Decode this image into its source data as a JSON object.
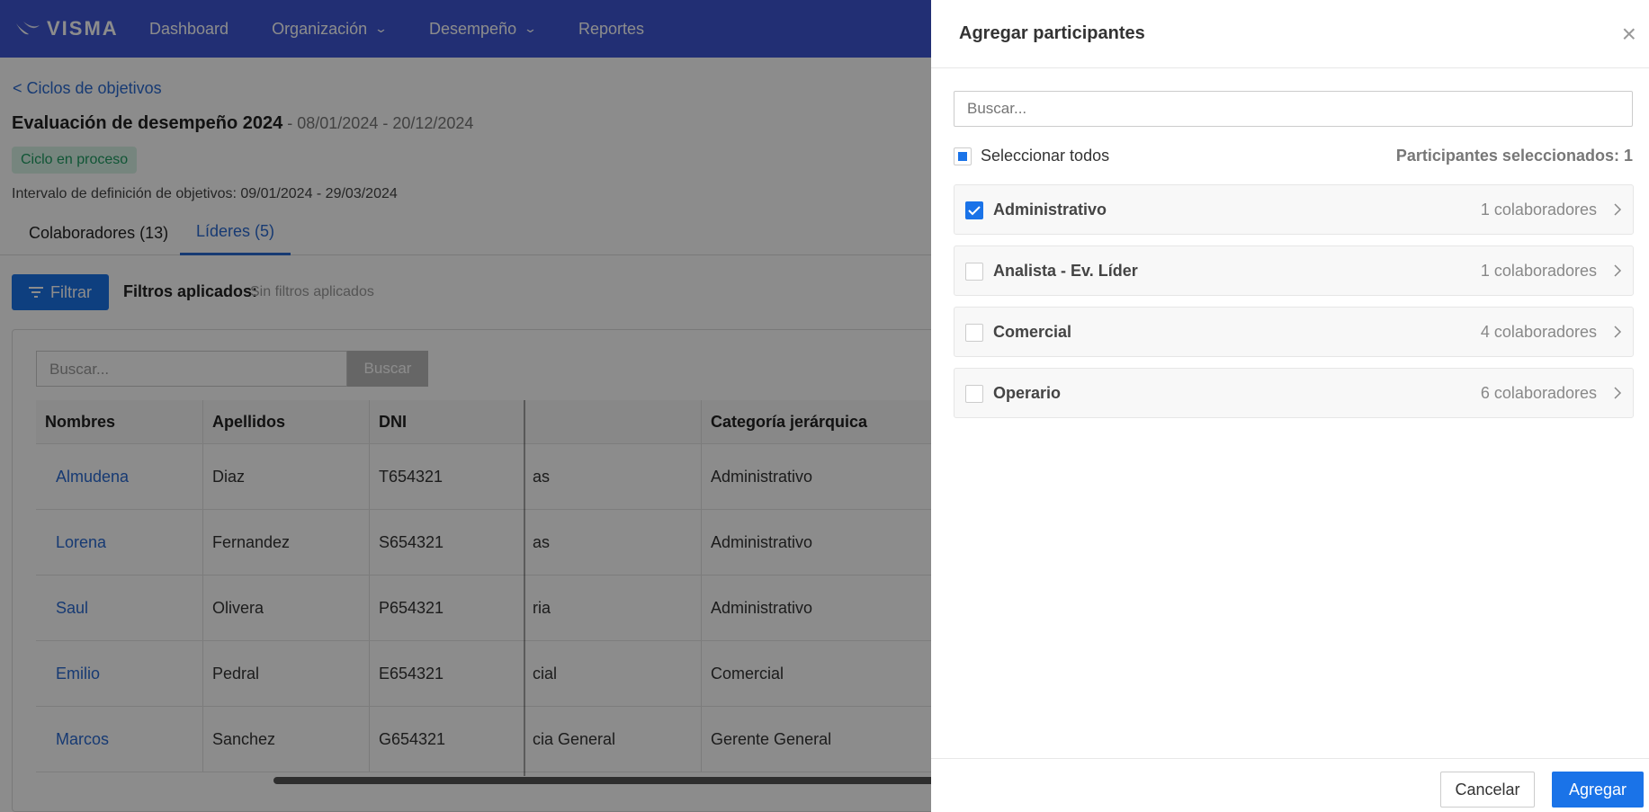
{
  "topnav": {
    "logo": "VISMA",
    "items": [
      "Dashboard",
      "Organización",
      "Desempeño",
      "Reportes"
    ]
  },
  "page": {
    "back_link": "< Ciclos de objetivos",
    "title": "Evaluación de desempeño 2024",
    "dates": " - 08/01/2024 - 20/12/2024",
    "status": "Ciclo en proceso",
    "interval": "Intervalo de definición de objetivos: 09/01/2024 - 29/03/2024",
    "tabs": [
      "Colaboradores (13)",
      "Líderes (5)"
    ],
    "filter_button": "Filtrar",
    "filters_label": "Filtros aplicados:",
    "filters_value": "Sin filtros aplicados",
    "search_placeholder": "Buscar...",
    "search_button": "Buscar",
    "table": {
      "headers": [
        "Nombres",
        "Apellidos",
        "DNI",
        "",
        "Categoría jerárquica"
      ],
      "rows": [
        [
          "Almudena",
          "Diaz",
          "T654321",
          "as",
          "Administrativo"
        ],
        [
          "Lorena",
          "Fernandez",
          "S654321",
          "as",
          "Administrativo"
        ],
        [
          "Saul",
          "Olivera",
          "P654321",
          "ria",
          "Administrativo"
        ],
        [
          "Emilio",
          "Pedral",
          "E654321",
          "cial",
          "Comercial"
        ],
        [
          "Marcos",
          "Sanchez",
          "G654321",
          "cia General",
          "Gerente General"
        ]
      ]
    }
  },
  "drawer": {
    "title": "Agregar participantes",
    "search_placeholder": "Buscar...",
    "select_all": "Seleccionar todos",
    "selected_count": "Participantes seleccionados: 1",
    "groups": [
      {
        "name": "Administrativo",
        "count": "1 colaboradores",
        "checked": true
      },
      {
        "name": "Analista - Ev. Líder",
        "count": "1 colaboradores",
        "checked": false
      },
      {
        "name": "Comercial",
        "count": "4 colaboradores",
        "checked": false
      },
      {
        "name": "Operario",
        "count": "6 colaboradores",
        "checked": false
      }
    ],
    "cancel": "Cancelar",
    "add": "Agregar"
  }
}
